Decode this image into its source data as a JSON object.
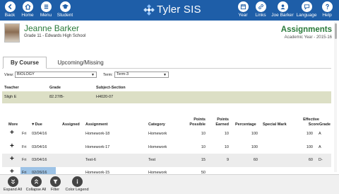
{
  "brand": {
    "title": "Tyler SIS"
  },
  "topnav_left": [
    {
      "label": "Back",
      "icon": "back-icon"
    },
    {
      "label": "Home",
      "icon": "home-icon"
    },
    {
      "label": "Menu",
      "icon": "menu-icon"
    },
    {
      "label": "Student",
      "icon": "student-icon"
    }
  ],
  "topnav_right": [
    {
      "label": "Year",
      "icon": "calendar-icon"
    },
    {
      "label": "Links",
      "icon": "link-icon"
    },
    {
      "label": "Joe Barker",
      "icon": "user-icon"
    },
    {
      "label": "Language",
      "icon": "chat-icon"
    },
    {
      "label": "Help",
      "icon": "help-icon"
    }
  ],
  "student": {
    "name": "Jeanne Barker",
    "info": "Grade 11 - Edwards High School"
  },
  "page": {
    "title": "Assignments",
    "subtitle": "Academic Year - 2015-16"
  },
  "tabs": [
    {
      "label": "By Course"
    },
    {
      "label": "Upcoming/Missing"
    }
  ],
  "filters": {
    "view_label": "View:",
    "view_value": "BIOLOGY",
    "term_label": "Term:",
    "term_value": "Term-3"
  },
  "course": {
    "headers": {
      "teacher": "Teacher",
      "grade": "Grade",
      "section": "Subject-Section"
    },
    "row": {
      "teacher": "Sligh E",
      "grade": "82.27/B-",
      "section": "H4020-07"
    }
  },
  "assign_headers": {
    "more": "More",
    "due": "▼Due",
    "assigned": "Assigned",
    "assignment": "Assignment",
    "category": "Category",
    "points_possible": "Points Possible",
    "points_earned": "Points Earned",
    "percentage": "Percentage",
    "special_mark": "Special Mark",
    "effective_score": "Effective Score",
    "grade": "Grade"
  },
  "assignments": [
    {
      "day": "Fri",
      "due": "03/04/16",
      "assignment": "Homework-18",
      "category": "Homework",
      "points_possible": "10",
      "points_earned": "10",
      "percentage": "100",
      "effective_score": "100",
      "grade": "A"
    },
    {
      "day": "Fri",
      "due": "03/04/16",
      "assignment": "Homework-17",
      "category": "Homework",
      "points_possible": "10",
      "points_earned": "10",
      "percentage": "100",
      "effective_score": "100",
      "grade": "A"
    },
    {
      "day": "Fri",
      "due": "03/04/16",
      "assignment": "Test-6",
      "category": "Test",
      "points_possible": "15",
      "points_earned": "9",
      "percentage": "60",
      "effective_score": "60",
      "grade": "D-"
    },
    {
      "day": "Fri",
      "due": "02/26/16",
      "assignment": "Homework-15",
      "category": "Homework",
      "points_possible": "50",
      "points_earned": "",
      "percentage": "",
      "effective_score": "",
      "grade": ""
    }
  ],
  "bottom_actions": [
    {
      "label": "Expand All",
      "icon": "expand-icon"
    },
    {
      "label": "Collapse All",
      "icon": "collapse-icon"
    },
    {
      "label": "Filter",
      "icon": "filter-icon"
    },
    {
      "label": "Color Legend",
      "icon": "info-icon"
    }
  ],
  "colors": {
    "header_bar": "#1e5ea8",
    "accent_green": "#2a7a3a",
    "course_row": "#dcdfc5",
    "due_highlight": "#9dc3e6"
  }
}
